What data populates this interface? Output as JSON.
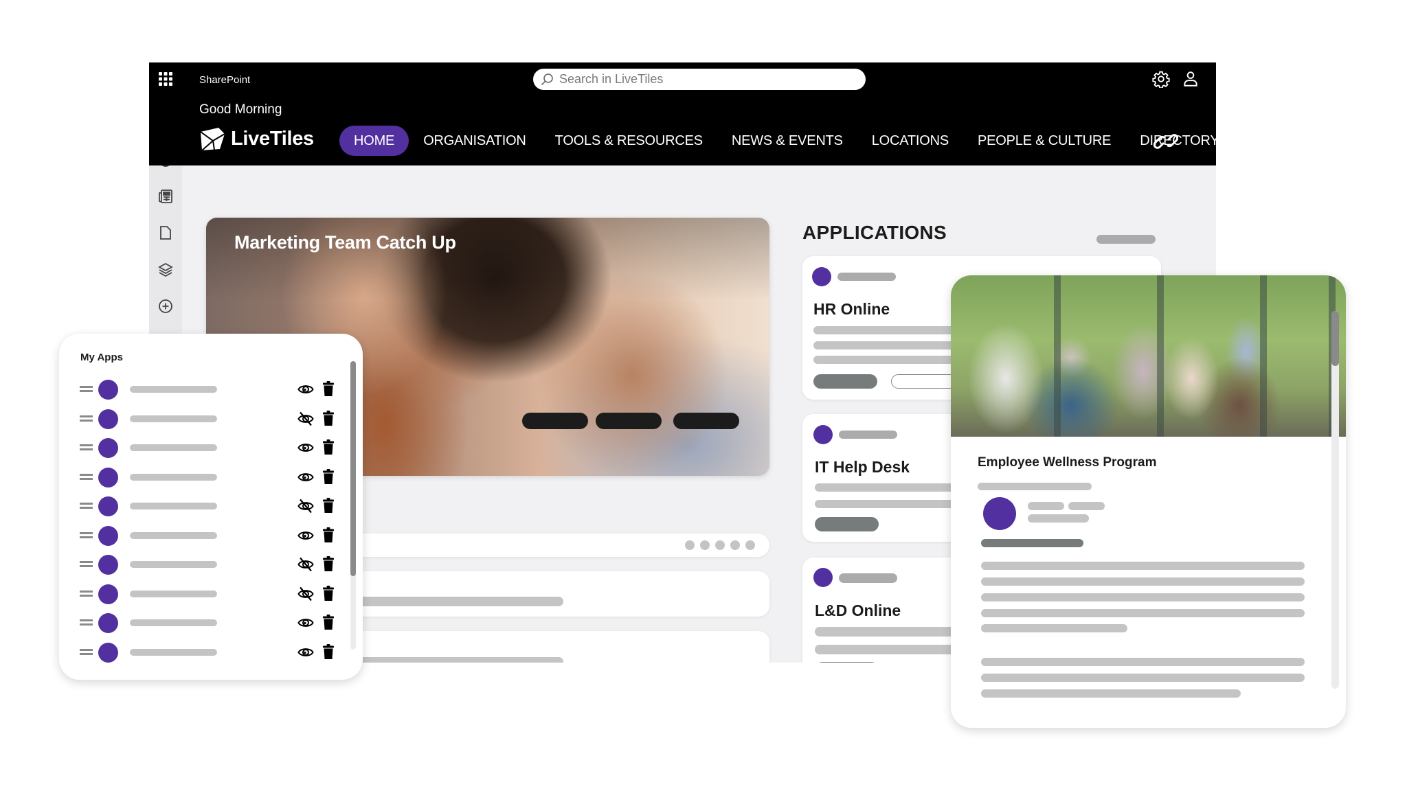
{
  "topbar": {
    "app_name": "SharePoint",
    "search_placeholder": "Search in LiveTiles",
    "greeting": "Good Morning",
    "brand": "LiveTiles",
    "icons": {
      "waffle": "app-launcher-icon",
      "settings": "gear-icon",
      "user": "user-icon",
      "link": "link-icon",
      "search": "search-icon"
    }
  },
  "nav": {
    "items": [
      {
        "label": "HOME",
        "active": true
      },
      {
        "label": "ORGANISATION",
        "active": false
      },
      {
        "label": "TOOLS & RESOURCES",
        "active": false
      },
      {
        "label": "NEWS & EVENTS",
        "active": false
      },
      {
        "label": "LOCATIONS",
        "active": false
      },
      {
        "label": "PEOPLE & CULTURE",
        "active": false
      },
      {
        "label": "DIRECTORY",
        "active": false
      }
    ]
  },
  "rail": {
    "items": [
      "home-icon",
      "globe-icon",
      "news-icon",
      "document-icon",
      "layers-icon",
      "add-circle-icon"
    ]
  },
  "hero": {
    "title": "Marketing Team Catch Up",
    "button_count": 3
  },
  "pager": {
    "dot_count": 5
  },
  "applications": {
    "title": "APPLICATIONS",
    "cards": [
      {
        "name": "HR Online"
      },
      {
        "name": "IT Help Desk"
      },
      {
        "name": "L&D Online"
      }
    ]
  },
  "my_apps": {
    "title": "My Apps",
    "rows": [
      {
        "visible": true
      },
      {
        "visible": false
      },
      {
        "visible": true
      },
      {
        "visible": true
      },
      {
        "visible": false
      },
      {
        "visible": true
      },
      {
        "visible": false
      },
      {
        "visible": false
      },
      {
        "visible": true
      },
      {
        "visible": true
      }
    ]
  },
  "wellness": {
    "title": "Employee Wellness Program"
  },
  "colors": {
    "accent": "#5230a0",
    "topbar": "#000000",
    "canvas": "#f1f1f3",
    "placeholder_light": "#c4c4c4",
    "placeholder_dark": "#767c7c"
  }
}
